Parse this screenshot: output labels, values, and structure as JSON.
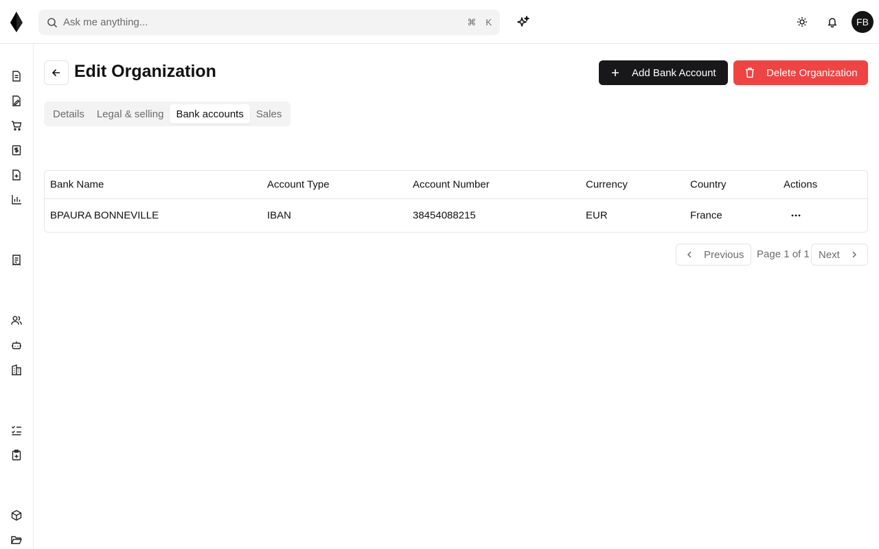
{
  "search": {
    "placeholder": "Ask me anything...",
    "shortcut_mod": "⌘",
    "shortcut_key": "K"
  },
  "user": {
    "initials": "FB"
  },
  "page": {
    "title": "Edit Organization"
  },
  "buttons": {
    "add_bank_account": "Add Bank Account",
    "delete_organization": "Delete Organization"
  },
  "tabs": [
    {
      "label": "Details",
      "active": false
    },
    {
      "label": "Legal & selling",
      "active": false
    },
    {
      "label": "Bank accounts",
      "active": true
    },
    {
      "label": "Sales",
      "active": false
    }
  ],
  "table": {
    "headers": [
      "Bank Name",
      "Account Type",
      "Account Number",
      "Currency",
      "Country",
      "Actions"
    ],
    "rows": [
      [
        "BPAURA BONNEVILLE",
        "IBAN",
        "38454088215",
        "EUR",
        "France"
      ]
    ]
  },
  "pagination": {
    "previous": "Previous",
    "page_info": "Page 1 of 1",
    "next": "Next"
  },
  "colors": {
    "primary": "#18181b",
    "danger": "#ef4444",
    "surface": "#f3f3f3"
  },
  "sidebar_icons": [
    "invoice-icon",
    "quote-icon",
    "cart-icon",
    "payment-icon",
    "credit-note-icon",
    "chart-icon",
    "expense-icon",
    "users-icon",
    "bot-icon",
    "organization-icon",
    "tasks-icon",
    "clipboard-icon",
    "products-icon",
    "folder-icon"
  ]
}
